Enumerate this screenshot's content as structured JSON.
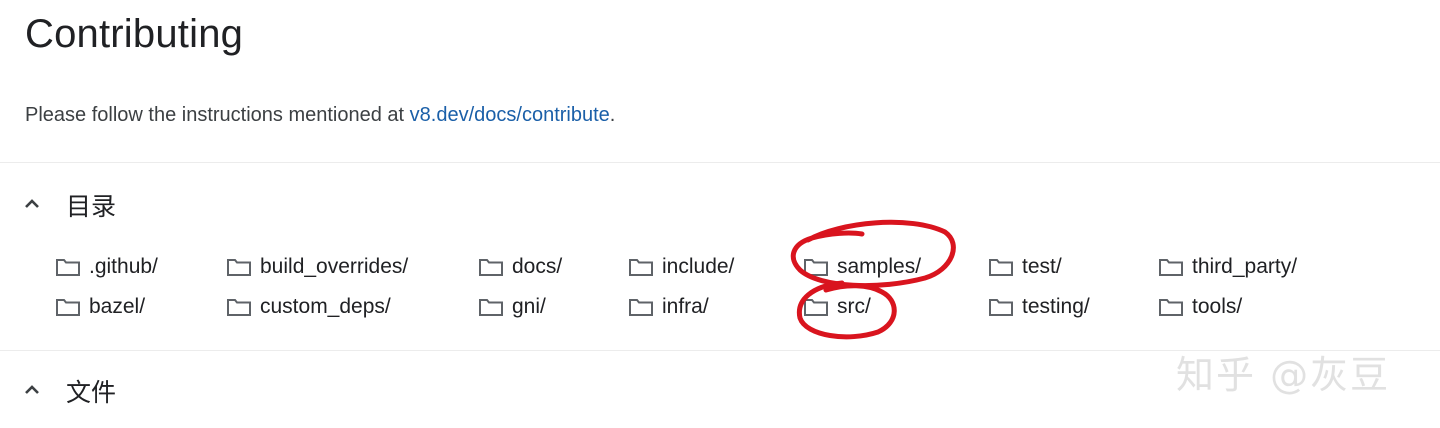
{
  "title": "Contributing",
  "intro": {
    "text": "Please follow the instructions mentioned at ",
    "link_text": "v8.dev/docs/contribute",
    "suffix": "."
  },
  "sections": {
    "directories_label": "目录",
    "files_label": "文件"
  },
  "directories": [
    ".github/",
    "bazel/",
    "build_overrides/",
    "custom_deps/",
    "docs/",
    "gni/",
    "include/",
    "infra/",
    "samples/",
    "src/",
    "test/",
    "testing/",
    "third_party/",
    "tools/"
  ],
  "icons": {
    "folder": "folder-icon",
    "chevron": "chevron-up-icon"
  },
  "colors": {
    "link": "#1a5fa8",
    "annotation": "#d9141e",
    "text": "#202124"
  },
  "watermark": "知乎 @灰豆"
}
